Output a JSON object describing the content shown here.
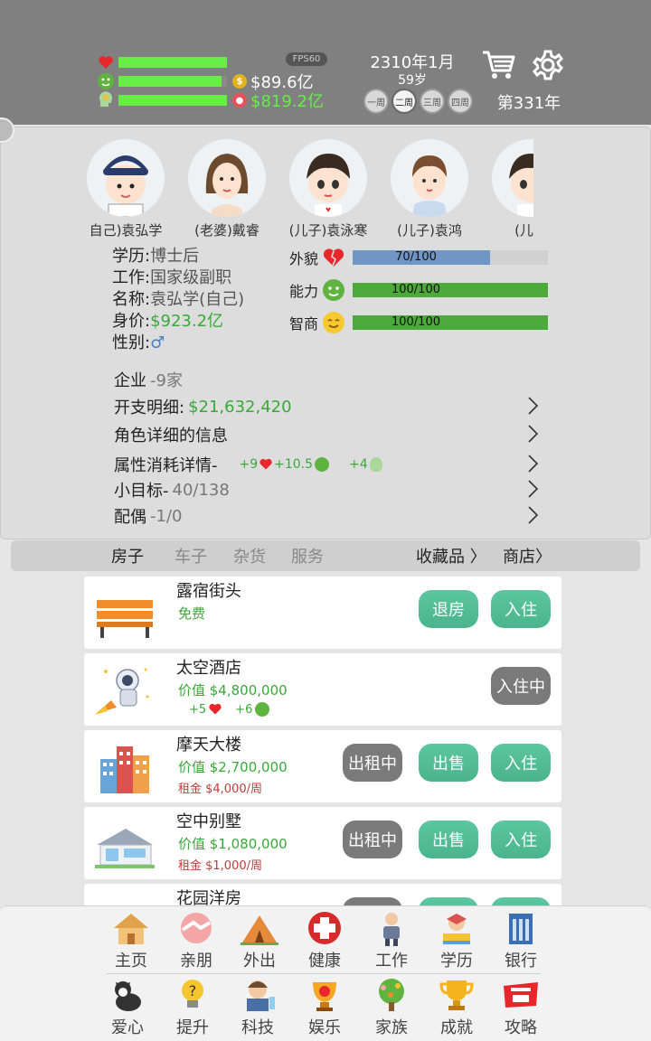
{
  "header": {
    "stats": [
      {
        "icon": "heart-icon",
        "fill": 1.0
      },
      {
        "icon": "face-icon",
        "fill": 0.95
      },
      {
        "icon": "brain-icon",
        "fill": 1.0
      }
    ],
    "money": {
      "value": "$89.6亿",
      "icon": "coin-icon"
    },
    "assets": {
      "value": "$819.2亿",
      "icon": "piggy-icon"
    },
    "fps": "FPS60",
    "date": "2310年1月",
    "age": "59岁",
    "weeks": [
      "一周",
      "二周",
      "三周",
      "四周"
    ],
    "active_week": 1,
    "year": "第331年"
  },
  "members": [
    {
      "label": "自己)袁弘学",
      "hair": "#2b3c6b",
      "cap": true
    },
    {
      "label": "(老婆)戴睿",
      "hair": "#6b4a2e"
    },
    {
      "label": "(儿子)袁泳寒",
      "hair": "#3a2b22"
    },
    {
      "label": "(儿子)袁鸿",
      "hair": "#7a4f30"
    },
    {
      "label": "(儿子",
      "hair": "#3a2b22"
    }
  ],
  "profile": {
    "edu_k": "学历:",
    "edu_v": "博士后",
    "job_k": "工作:",
    "job_v": "国家级副职",
    "name_k": "名称:",
    "name_v": "袁弘学(自己)",
    "worth_k": "身价:",
    "worth_v": "$923.2亿",
    "gender_k": "性别:",
    "gender_v": "♂"
  },
  "attributes": [
    {
      "label": "外貌",
      "text": "70/100",
      "value": 70,
      "max": 100,
      "color": "#6f96c4",
      "icon": "broken-heart-icon"
    },
    {
      "label": "能力",
      "text": "100/100",
      "value": 100,
      "max": 100,
      "color": "#4caa3a",
      "icon": "green-face-icon"
    },
    {
      "label": "智商",
      "text": "100/100",
      "value": 100,
      "max": 100,
      "color": "#4caa3a",
      "icon": "smile-face-icon"
    }
  ],
  "details": {
    "company_k": "企业",
    "company_v": "-9家",
    "expense_k": "开支明细:",
    "expense_v": "$21,632,420",
    "role_info": "角色详细的信息",
    "attr_cost_k": "属性消耗详情-",
    "cost_heart": "+9",
    "cost_face": "+10.5",
    "cost_brain": "+4",
    "goal_k": "小目标-",
    "goal_v": "40/138",
    "spouse_k": "配偶",
    "spouse_v": "-1/0"
  },
  "tabs": {
    "house": "房子",
    "car": "车子",
    "goods": "杂货",
    "service": "服务",
    "collection": "收藏品 〉",
    "shop": "商店〉"
  },
  "houses": [
    {
      "name": "露宿街头",
      "line1": "免费",
      "btn_refund": "退房",
      "btn_live": "入住"
    },
    {
      "name": "太空酒店",
      "line1": "价值 $4,800,000",
      "bonus_heart": "+5",
      "bonus_face": "+6",
      "btn_living": "入住中"
    },
    {
      "name": "摩天大楼",
      "line1": "价值 $2,700,000",
      "line2": "租金 $4,000/周",
      "btn_rent": "出租中",
      "btn_sell": "出售",
      "btn_live": "入住"
    },
    {
      "name": "空中别墅",
      "line1": "价值 $1,080,000",
      "line2": "租金 $1,000/周",
      "btn_rent": "出租中",
      "btn_sell": "出售",
      "btn_live": "入住"
    },
    {
      "name": "花园洋房"
    }
  ],
  "nav": {
    "row1": [
      "主页",
      "亲朋",
      "外出",
      "健康",
      "工作",
      "学历",
      "银行"
    ],
    "row2": [
      "爱心",
      "提升",
      "科技",
      "娱乐",
      "家族",
      "成就",
      "攻略"
    ]
  },
  "colors": {
    "accent_green": "#3aa83a",
    "button_teal": "#4bb48f",
    "header_gray": "#808080",
    "bar_green": "#66ee44"
  }
}
